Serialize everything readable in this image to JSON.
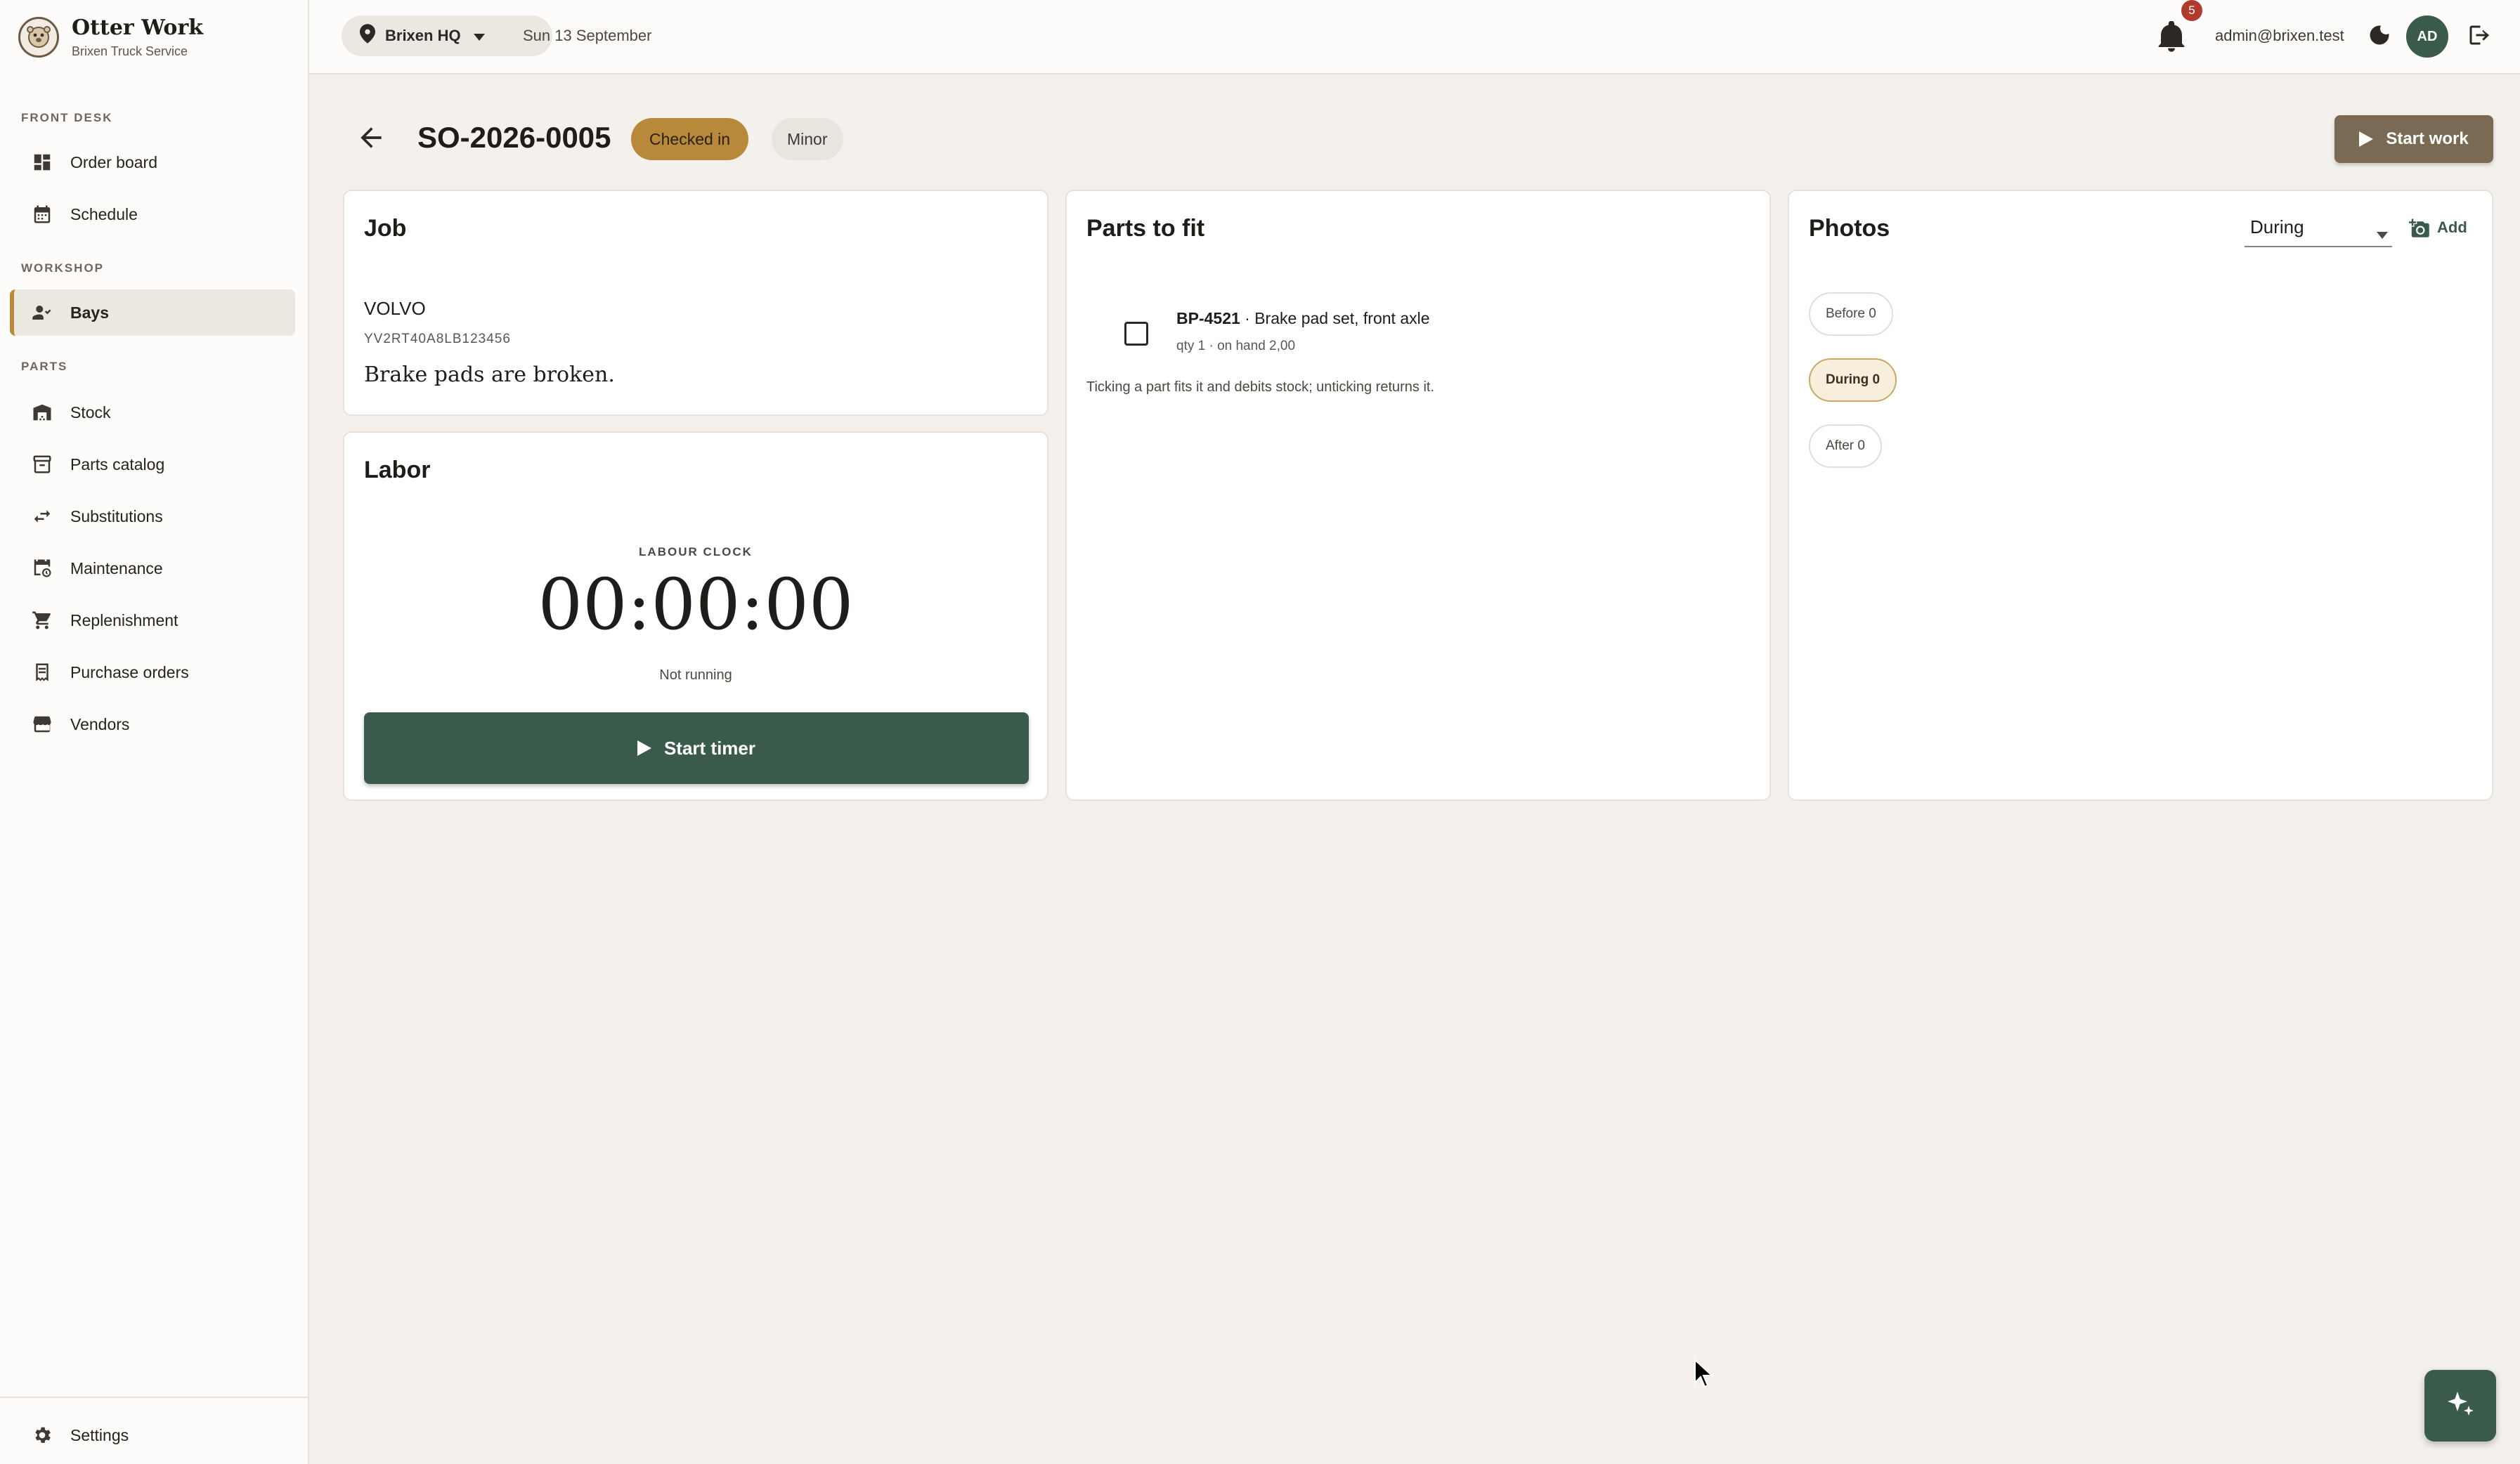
{
  "brand": {
    "name": "Otter Work",
    "subtitle": "Brixen Truck Service"
  },
  "sidebar": {
    "sections": [
      {
        "label": "FRONT DESK"
      },
      {
        "label": "WORKSHOP"
      },
      {
        "label": "PARTS"
      }
    ],
    "items": [
      {
        "label": "Order board",
        "icon": "dashboard-icon"
      },
      {
        "label": "Schedule",
        "icon": "calendar-icon"
      },
      {
        "label": "Bays",
        "icon": "people-icon",
        "active": true
      },
      {
        "label": "Stock",
        "icon": "warehouse-icon"
      },
      {
        "label": "Parts catalog",
        "icon": "archive-icon"
      },
      {
        "label": "Substitutions",
        "icon": "swap-icon"
      },
      {
        "label": "Maintenance",
        "icon": "calendar-clock-icon"
      },
      {
        "label": "Replenishment",
        "icon": "cart-icon"
      },
      {
        "label": "Purchase orders",
        "icon": "receipt-icon"
      },
      {
        "label": "Vendors",
        "icon": "store-icon"
      }
    ],
    "settings_label": "Settings"
  },
  "topbar": {
    "location": "Brixen HQ",
    "date": "Sun 13 September",
    "notification_count": "5",
    "user_email": "admin@brixen.test",
    "avatar_initials": "AD"
  },
  "order": {
    "number": "SO-2026-0005",
    "status": "Checked in",
    "severity": "Minor",
    "start_work_label": "Start work"
  },
  "job": {
    "title": "Job",
    "make": "VOLVO",
    "vin": "YV2RT40A8LB123456",
    "description": "Brake pads are broken."
  },
  "labor": {
    "title": "Labor",
    "clock_label": "LABOUR CLOCK",
    "clock_value": "00:00:00",
    "clock_status": "Not running",
    "start_timer_label": "Start timer"
  },
  "parts": {
    "title": "Parts to fit",
    "items": [
      {
        "code": "BP-4521",
        "name": " · Brake pad set, front axle",
        "meta": "qty 1 · on hand 2,00",
        "checked": false
      }
    ],
    "hint": "Ticking a part fits it and debits stock; unticking returns it."
  },
  "photos": {
    "title": "Photos",
    "phase_selected": "During",
    "add_label": "Add",
    "filters": [
      {
        "label": "Before 0"
      },
      {
        "label": "During 0",
        "active": true
      },
      {
        "label": "After 0"
      }
    ]
  },
  "colors": {
    "accent": "#b8893a",
    "primary": "#3a5a4c",
    "start_work": "#7a6a53",
    "badge": "#b03a2e"
  }
}
